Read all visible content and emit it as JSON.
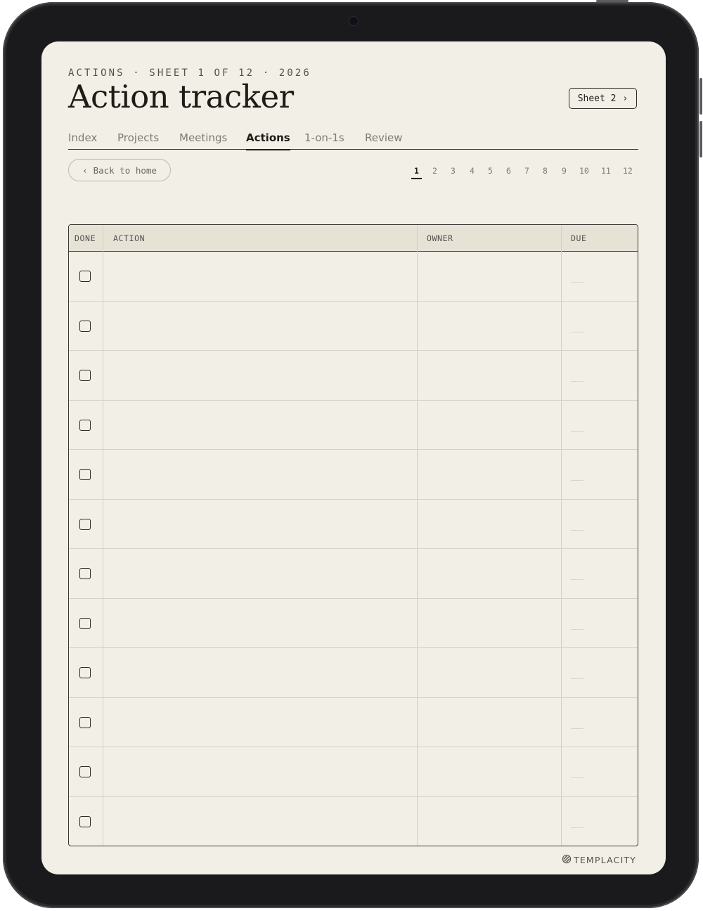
{
  "header": {
    "eyebrow": "ACTIONS · SHEET 1 OF 12 · 2026",
    "title": "Action tracker",
    "next_sheet_label": "Sheet 2",
    "next_sheet_icon": "chevron-right-icon"
  },
  "tabs": [
    {
      "label": "Index",
      "active": false
    },
    {
      "label": "Projects",
      "active": false
    },
    {
      "label": "Meetings",
      "active": false
    },
    {
      "label": "Actions",
      "active": true
    },
    {
      "label": "1-on-1s",
      "active": false
    },
    {
      "label": "Review",
      "active": false
    }
  ],
  "back_link": {
    "label": "Back to home",
    "icon": "chevron-left-icon"
  },
  "pager": {
    "pages": [
      "1",
      "2",
      "3",
      "4",
      "5",
      "6",
      "7",
      "8",
      "9",
      "10",
      "11",
      "12"
    ],
    "current": "1"
  },
  "table": {
    "columns": {
      "done": "DONE",
      "action": "ACTION",
      "owner": "OWNER",
      "due": "DUE"
    },
    "rows": [
      {
        "done": false,
        "action": "",
        "owner": "",
        "due": "___"
      },
      {
        "done": false,
        "action": "",
        "owner": "",
        "due": "___"
      },
      {
        "done": false,
        "action": "",
        "owner": "",
        "due": "___"
      },
      {
        "done": false,
        "action": "",
        "owner": "",
        "due": "___"
      },
      {
        "done": false,
        "action": "",
        "owner": "",
        "due": "___"
      },
      {
        "done": false,
        "action": "",
        "owner": "",
        "due": "___"
      },
      {
        "done": false,
        "action": "",
        "owner": "",
        "due": "___"
      },
      {
        "done": false,
        "action": "",
        "owner": "",
        "due": "___"
      },
      {
        "done": false,
        "action": "",
        "owner": "",
        "due": "___"
      },
      {
        "done": false,
        "action": "",
        "owner": "",
        "due": "___"
      },
      {
        "done": false,
        "action": "",
        "owner": "",
        "due": "___"
      },
      {
        "done": false,
        "action": "",
        "owner": "",
        "due": "___"
      }
    ]
  },
  "brand": {
    "name": "TEMPLACITY",
    "icon": "templacity-logo-icon"
  },
  "colors": {
    "paper": "#f2efe6",
    "ink": "#1d1c18",
    "muted": "#7e7b72",
    "header_fill": "#e6e2d6"
  }
}
